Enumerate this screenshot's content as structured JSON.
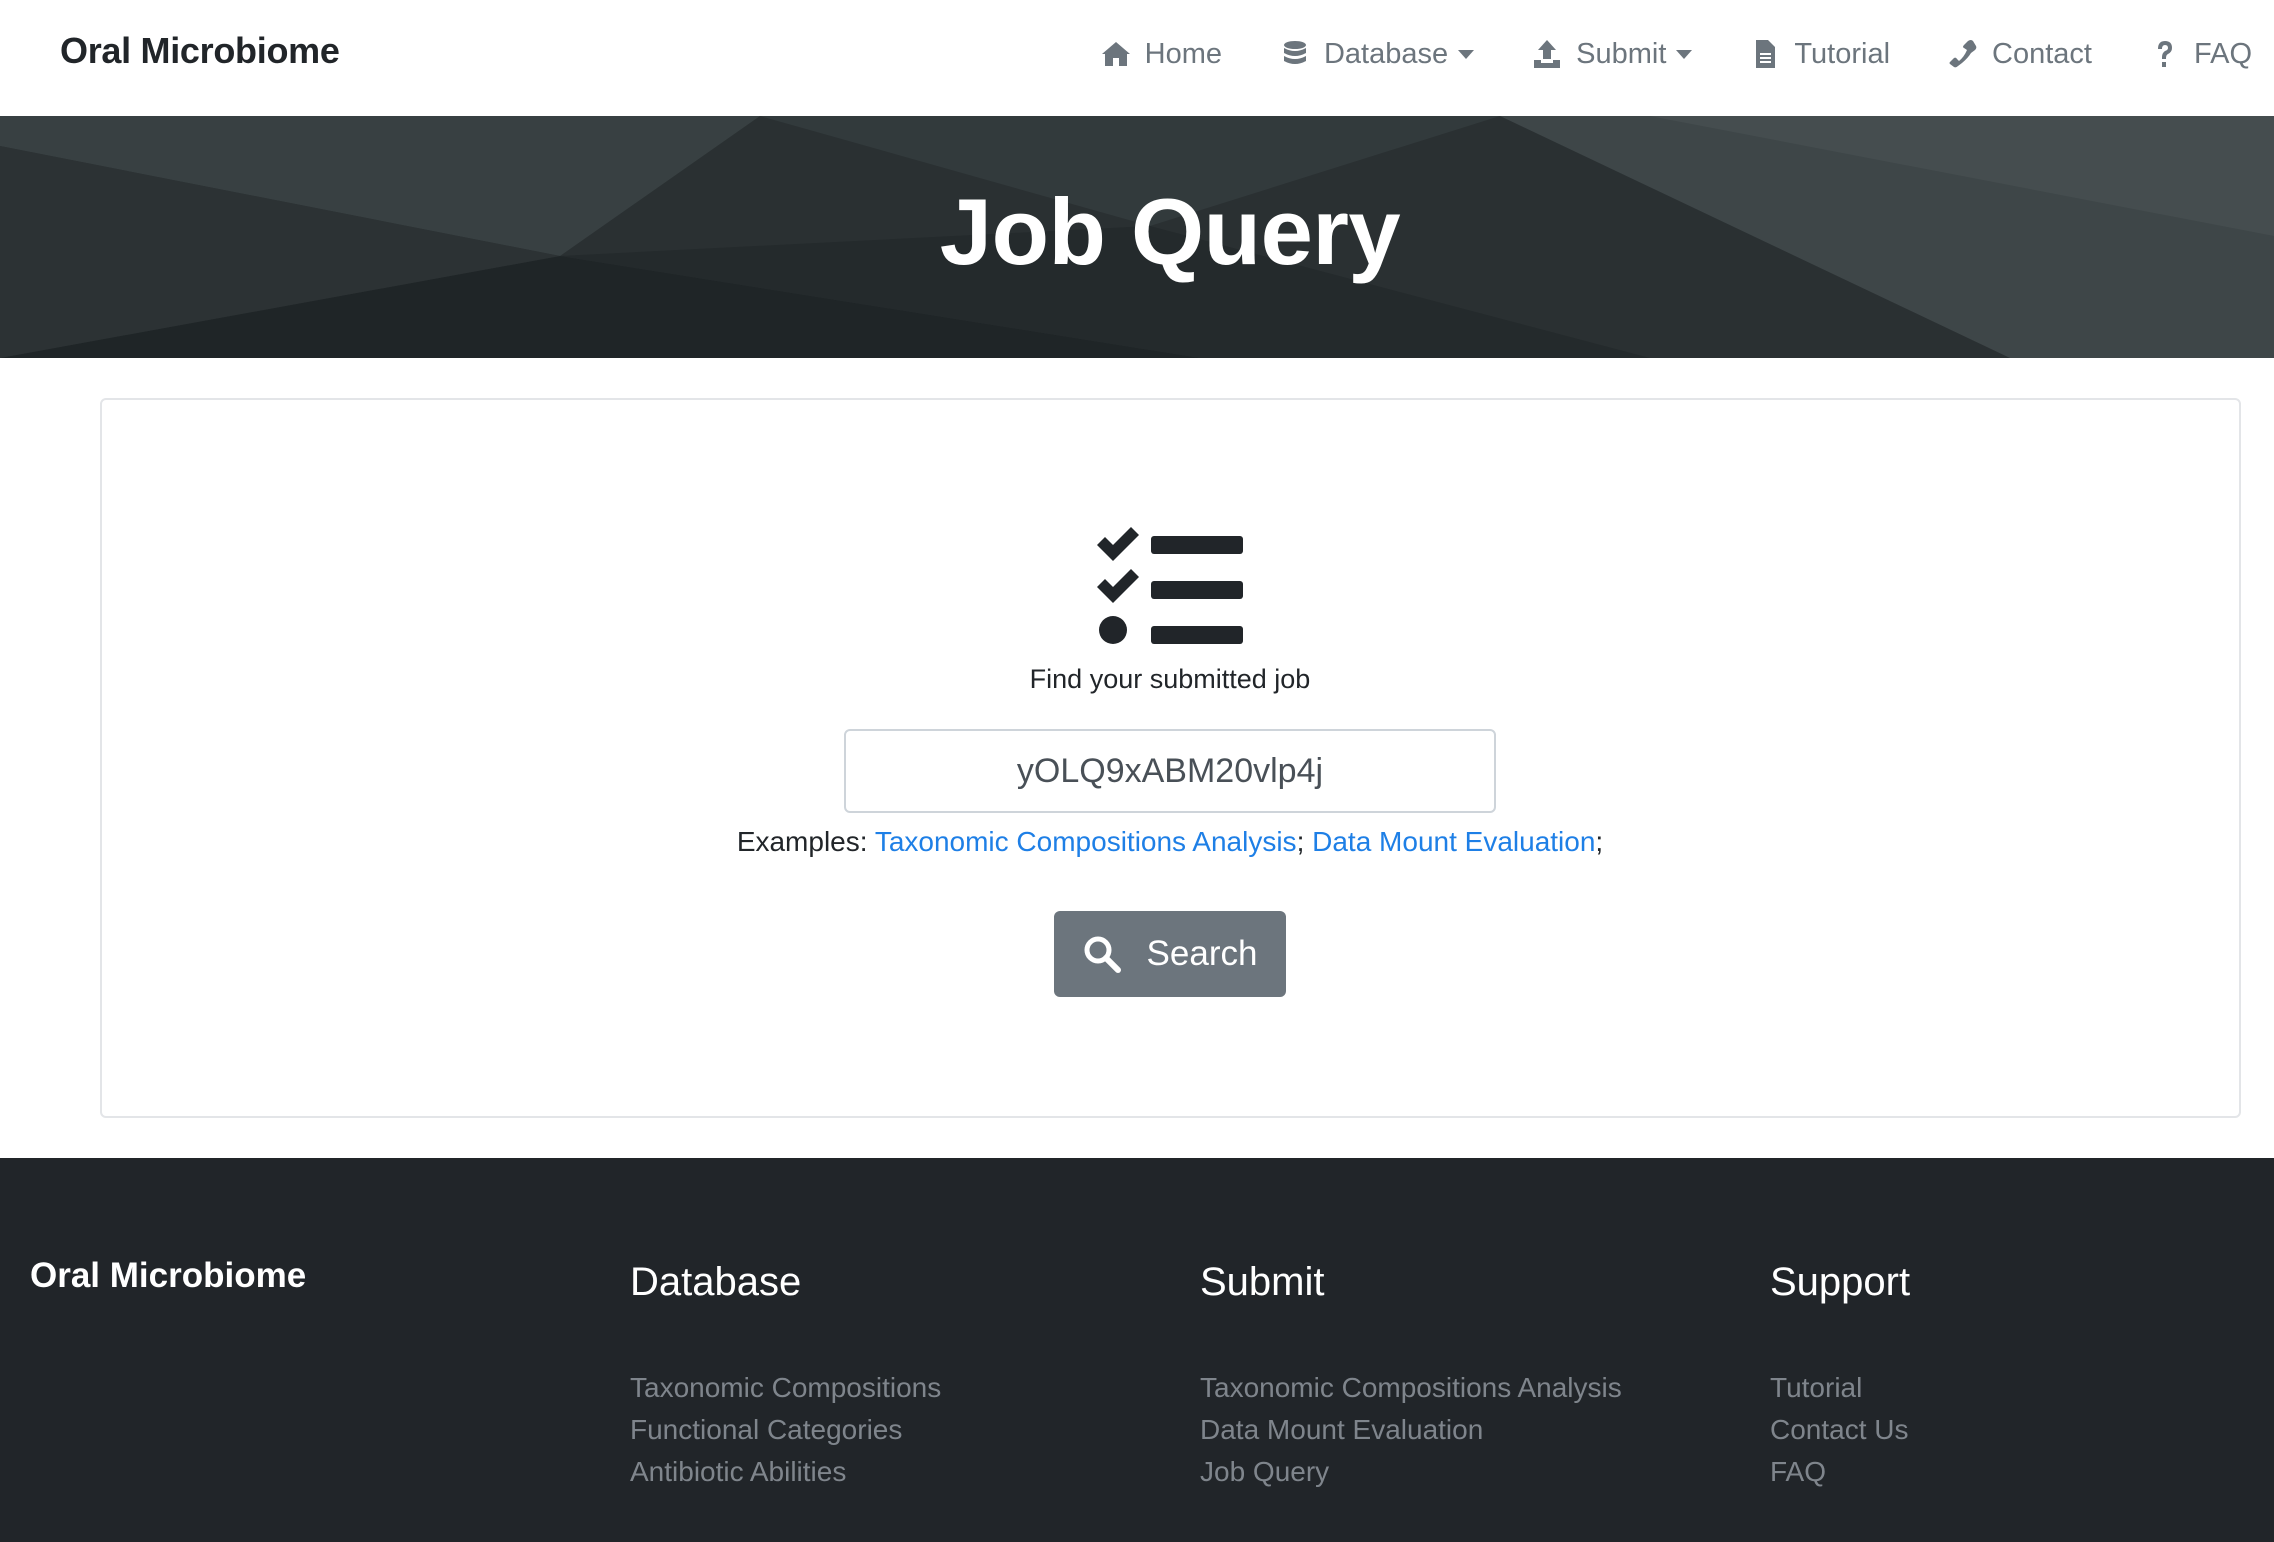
{
  "navbar": {
    "brand": "Oral Microbiome",
    "items": [
      {
        "label": "Home",
        "icon": "home-icon"
      },
      {
        "label": "Database",
        "icon": "database-icon",
        "dropdown": true
      },
      {
        "label": "Submit",
        "icon": "upload-icon",
        "dropdown": true
      },
      {
        "label": "Tutorial",
        "icon": "file-icon"
      },
      {
        "label": "Contact",
        "icon": "phone-icon"
      },
      {
        "label": "FAQ",
        "icon": "question-icon"
      }
    ]
  },
  "hero": {
    "title": "Job Query"
  },
  "query": {
    "icon": "tasks-icon",
    "subtitle": "Find your submitted job",
    "input_value": "yOLQ9xABM20vlp4j",
    "examples_label": "Examples:",
    "examples": [
      {
        "label": "Taxonomic Compositions Analysis"
      },
      {
        "label": "Data Mount Evaluation"
      }
    ],
    "search_label": "Search"
  },
  "footer": {
    "brand": "Oral Microbiome",
    "columns": [
      {
        "title": "Database",
        "links": [
          "Taxonomic Compositions",
          "Functional Categories",
          "Antibiotic Abilities"
        ]
      },
      {
        "title": "Submit",
        "links": [
          "Taxonomic Compositions Analysis",
          "Data Mount Evaluation",
          "Job Query"
        ]
      },
      {
        "title": "Support",
        "links": [
          "Tutorial",
          "Contact Us",
          "FAQ"
        ]
      }
    ]
  },
  "colors": {
    "link": "#1e7fe6",
    "button": "#6c757d",
    "hero_bg": "#2a3032",
    "footer_bg": "#212529"
  }
}
